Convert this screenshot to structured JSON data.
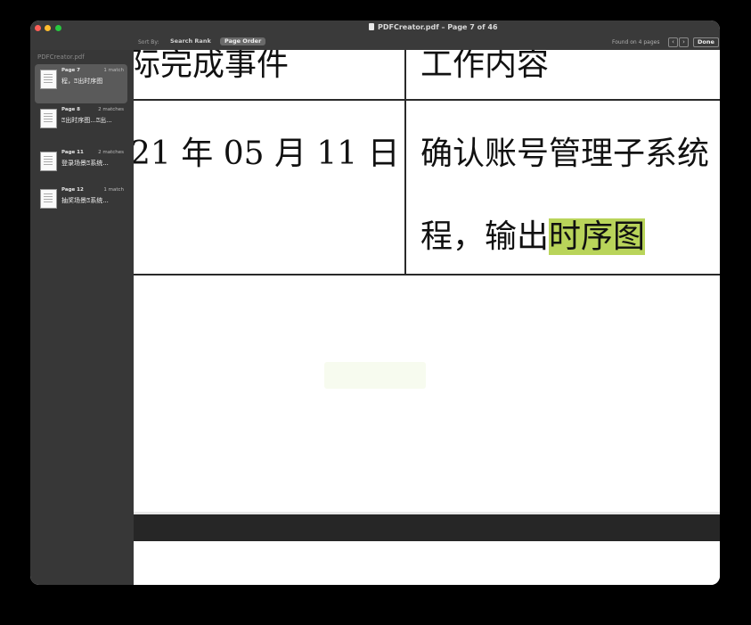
{
  "window": {
    "title": "PDFCreator.pdf – Page 7 of 46"
  },
  "toolbar": {
    "sort_by_label": "Sort By:",
    "search_rank_label": "Search Rank",
    "page_order_label": "Page Order",
    "found_text": "Found on 4 pages",
    "prev_label": "‹",
    "next_label": "›",
    "done_label": "Done"
  },
  "sidebar": {
    "header": "PDFCreator.pdf",
    "items": [
      {
        "page": "Page 7",
        "matches": "1 match",
        "snippet": "程，⍰出时序图"
      },
      {
        "page": "Page 8",
        "matches": "2 matches",
        "snippet": "⍰出时序图...⍰出..."
      },
      {
        "page": "Page 11",
        "matches": "2 matches",
        "snippet": "登录场景⍰系统..."
      },
      {
        "page": "Page 12",
        "matches": "1 match",
        "snippet": "抽奖场景⍰系统..."
      }
    ]
  },
  "document": {
    "cell_top_left": "际完成事件",
    "cell_top_right": "工作内容",
    "cell_date": "21 年 05 月 11 日",
    "cell_content_line1": "确认账号管理子系统",
    "cell_content_line2_prefix": "程，输出",
    "cell_content_line2_highlight": "时序图"
  },
  "colors": {
    "highlight": "#b9d45a",
    "titlebar": "#3a3a3a",
    "sidebar": "#373737"
  }
}
